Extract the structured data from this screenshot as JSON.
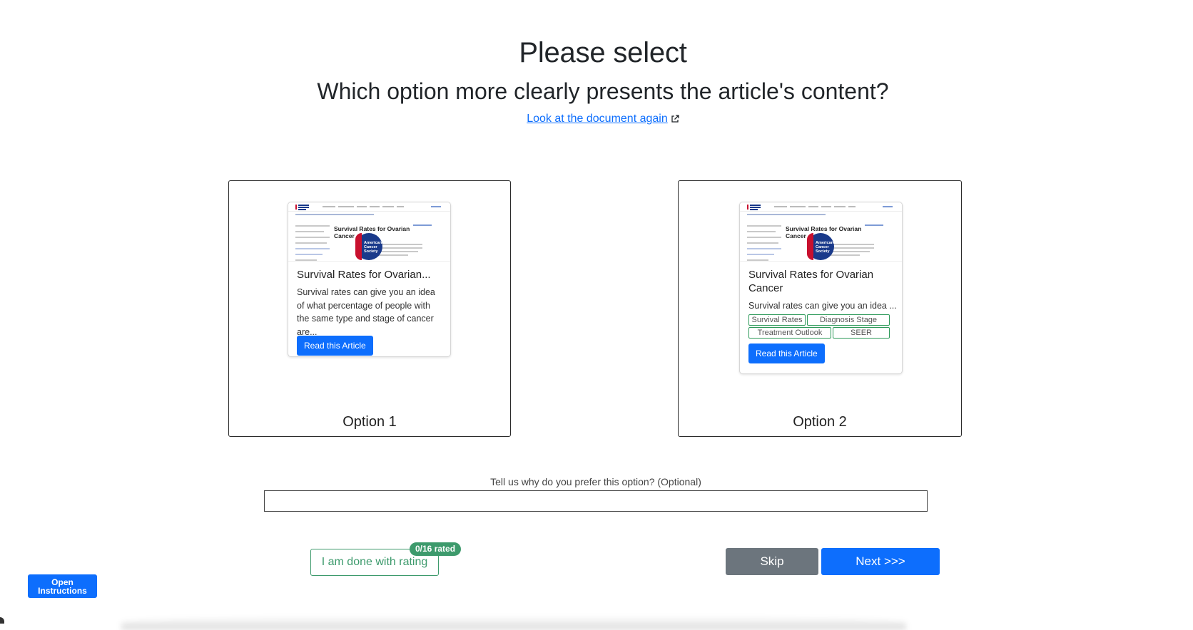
{
  "header": {
    "title": "Please select",
    "question": "Which option more clearly presents the article's content?",
    "doc_link": "Look at the document again"
  },
  "options": [
    {
      "label": "Option 1",
      "card": {
        "thumb_title": "Survival Rates for Ovarian Cancer",
        "seal_text": "American Cancer Society",
        "title": "Survival Rates for Ovarian...",
        "description": "Survival rates can give you an idea of what percentage of people with the same type and stage of cancer are...",
        "button": "Read this Article"
      }
    },
    {
      "label": "Option 2",
      "card": {
        "thumb_title": "Survival Rates for Ovarian Cancer",
        "seal_text": "American Cancer Society",
        "title": "Survival Rates for Ovarian Cancer",
        "description": "Survival rates can give you an idea ...",
        "tags": [
          "Survival Rates",
          "Diagnosis Stage",
          "Treatment Outlook",
          "SEER"
        ],
        "button": "Read this Article"
      }
    }
  ],
  "reason": {
    "label": "Tell us why do you prefer this option? (Optional)",
    "value": "",
    "placeholder": ""
  },
  "footer": {
    "done_label": "I am done with rating",
    "rated_badge": "0/16 rated",
    "skip_label": "Skip",
    "next_label": "Next >>>",
    "instructions_label": "Open Instructions"
  },
  "colors": {
    "primary": "#0d6efd",
    "secondary": "#6c757d",
    "success": "#3d9a6c",
    "acs_blue": "#1a3a8b",
    "acs_red": "#c8102e"
  },
  "icons": [
    "external-link-icon"
  ]
}
